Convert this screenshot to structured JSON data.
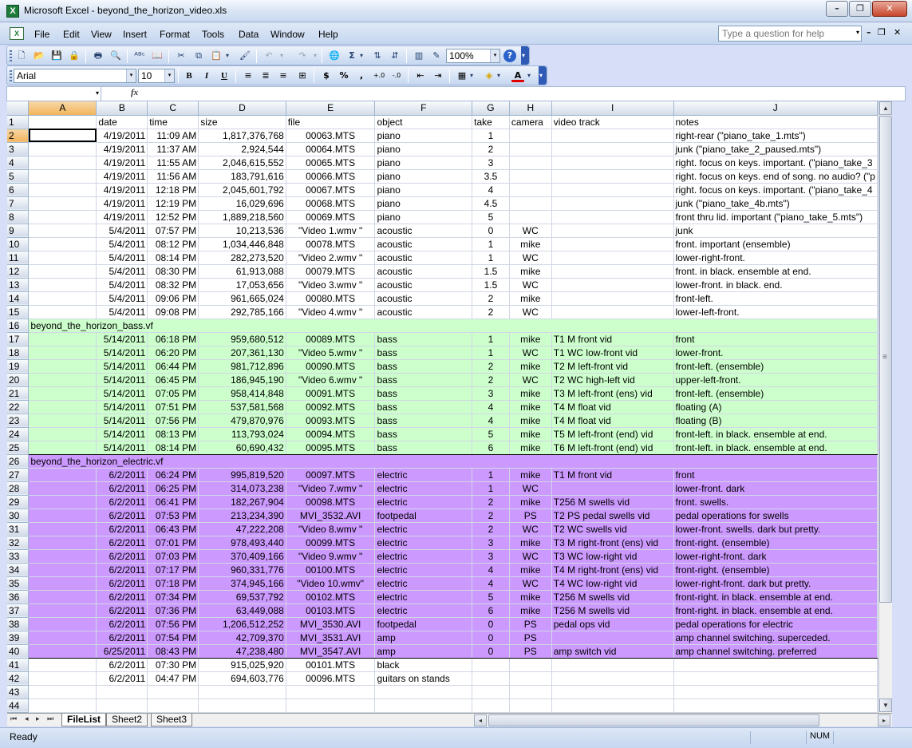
{
  "window": {
    "title": "Microsoft Excel - beyond_the_horizon_video.xls",
    "icon": "excel-icon",
    "app_icon_letter": "X",
    "doc_icon_letter": "X"
  },
  "menu": [
    "File",
    "Edit",
    "View",
    "Insert",
    "Format",
    "Tools",
    "Data",
    "Window",
    "Help"
  ],
  "help_placeholder": "Type a question for help",
  "toolbar": {
    "zoom": "100%",
    "font": "Arial",
    "font_size": "10"
  },
  "formula_bar": {
    "name_box": "",
    "fx": "fx",
    "formula": ""
  },
  "columns": [
    "A",
    "B",
    "C",
    "D",
    "E",
    "F",
    "G",
    "H",
    "I",
    "J"
  ],
  "rows": [
    {
      "n": "1",
      "A": "",
      "B": "date",
      "C": "time",
      "D": "size",
      "E": "file",
      "F": "object",
      "G": "take",
      "H": "camera",
      "I": "video track",
      "J": "notes",
      "hdr": true
    },
    {
      "n": "2",
      "A": "",
      "B": "4/19/2011",
      "C": "11:09 AM",
      "D": "1,817,376,768",
      "E": "00063.MTS",
      "F": "piano",
      "G": "1",
      "H": "",
      "I": "",
      "J": "right-rear (\"piano_take_1.mts\")"
    },
    {
      "n": "3",
      "A": "",
      "B": "4/19/2011",
      "C": "11:37 AM",
      "D": "2,924,544",
      "E": "00064.MTS",
      "F": "piano",
      "G": "2",
      "H": "",
      "I": "",
      "J": "junk (\"piano_take_2_paused.mts\")"
    },
    {
      "n": "4",
      "A": "",
      "B": "4/19/2011",
      "C": "11:55 AM",
      "D": "2,046,615,552",
      "E": "00065.MTS",
      "F": "piano",
      "G": "3",
      "H": "",
      "I": "",
      "J": "right. focus on keys. important. (\"piano_take_3"
    },
    {
      "n": "5",
      "A": "",
      "B": "4/19/2011",
      "C": "11:56 AM",
      "D": "183,791,616",
      "E": "00066.MTS",
      "F": "piano",
      "G": "3.5",
      "H": "",
      "I": "",
      "J": "right. focus on keys. end of song. no audio? (\"p"
    },
    {
      "n": "6",
      "A": "",
      "B": "4/19/2011",
      "C": "12:18 PM",
      "D": "2,045,601,792",
      "E": "00067.MTS",
      "F": "piano",
      "G": "4",
      "H": "",
      "I": "",
      "J": "right. focus on keys. important. (\"piano_take_4"
    },
    {
      "n": "7",
      "A": "",
      "B": "4/19/2011",
      "C": "12:19 PM",
      "D": "16,029,696",
      "E": "00068.MTS",
      "F": "piano",
      "G": "4.5",
      "H": "",
      "I": "",
      "J": "junk (\"piano_take_4b.mts\")"
    },
    {
      "n": "8",
      "A": "",
      "B": "4/19/2011",
      "C": "12:52 PM",
      "D": "1,889,218,560",
      "E": "00069.MTS",
      "F": "piano",
      "G": "5",
      "H": "",
      "I": "",
      "J": "front thru lid. important (\"piano_take_5.mts\")"
    },
    {
      "n": "9",
      "A": "",
      "B": "5/4/2011",
      "C": "07:57 PM",
      "D": "10,213,536",
      "E": "\"Video 1.wmv \"",
      "F": "acoustic",
      "G": "0",
      "H": "WC",
      "I": "",
      "J": "junk"
    },
    {
      "n": "10",
      "A": "",
      "B": "5/4/2011",
      "C": "08:12 PM",
      "D": "1,034,446,848",
      "E": "00078.MTS",
      "F": "acoustic",
      "G": "1",
      "H": "mike",
      "I": "",
      "J": "front. important (ensemble)"
    },
    {
      "n": "11",
      "A": "",
      "B": "5/4/2011",
      "C": "08:14 PM",
      "D": "282,273,520",
      "E": "\"Video 2.wmv \"",
      "F": "acoustic",
      "G": "1",
      "H": "WC",
      "I": "",
      "J": "lower-right-front."
    },
    {
      "n": "12",
      "A": "",
      "B": "5/4/2011",
      "C": "08:30 PM",
      "D": "61,913,088",
      "E": "00079.MTS",
      "F": "acoustic",
      "G": "1.5",
      "H": "mike",
      "I": "",
      "J": "front. in black. ensemble at end."
    },
    {
      "n": "13",
      "A": "",
      "B": "5/4/2011",
      "C": "08:32 PM",
      "D": "17,053,656",
      "E": "\"Video 3.wmv \"",
      "F": "acoustic",
      "G": "1.5",
      "H": "WC",
      "I": "",
      "J": "lower-front. in black. end."
    },
    {
      "n": "14",
      "A": "",
      "B": "5/4/2011",
      "C": "09:06 PM",
      "D": "961,665,024",
      "E": "00080.MTS",
      "F": "acoustic",
      "G": "2",
      "H": "mike",
      "I": "",
      "J": "front-left."
    },
    {
      "n": "15",
      "A": "",
      "B": "5/4/2011",
      "C": "09:08 PM",
      "D": "292,785,166",
      "E": "\"Video 4.wmv \"",
      "F": "acoustic",
      "G": "2",
      "H": "WC",
      "I": "",
      "J": "lower-left-front."
    },
    {
      "n": "16",
      "A": "beyond_the_horizon_bass.vf",
      "group": "green",
      "section": true
    },
    {
      "n": "17",
      "A": "",
      "B": "5/14/2011",
      "C": "06:18 PM",
      "D": "959,680,512",
      "E": "00089.MTS",
      "F": "bass",
      "G": "1",
      "H": "mike",
      "I": "T1 M front vid",
      "J": "front",
      "group": "green"
    },
    {
      "n": "18",
      "A": "",
      "B": "5/14/2011",
      "C": "06:20 PM",
      "D": "207,361,130",
      "E": "\"Video 5.wmv \"",
      "F": "bass",
      "G": "1",
      "H": "WC",
      "I": "T1 WC low-front vid",
      "J": "lower-front.",
      "group": "green"
    },
    {
      "n": "19",
      "A": "",
      "B": "5/14/2011",
      "C": "06:44 PM",
      "D": "981,712,896",
      "E": "00090.MTS",
      "F": "bass",
      "G": "2",
      "H": "mike",
      "I": "T2 M left-front vid",
      "J": "front-left. (ensemble)",
      "group": "green"
    },
    {
      "n": "20",
      "A": "",
      "B": "5/14/2011",
      "C": "06:45 PM",
      "D": "186,945,190",
      "E": "\"Video 6.wmv \"",
      "F": "bass",
      "G": "2",
      "H": "WC",
      "I": "T2 WC high-left vid",
      "J": "upper-left-front.",
      "group": "green"
    },
    {
      "n": "21",
      "A": "",
      "B": "5/14/2011",
      "C": "07:05 PM",
      "D": "958,414,848",
      "E": "00091.MTS",
      "F": "bass",
      "G": "3",
      "H": "mike",
      "I": "T3 M left-front (ens) vid",
      "J": "front-left. (ensemble)",
      "group": "green"
    },
    {
      "n": "22",
      "A": "",
      "B": "5/14/2011",
      "C": "07:51 PM",
      "D": "537,581,568",
      "E": "00092.MTS",
      "F": "bass",
      "G": "4",
      "H": "mike",
      "I": "T4 M float vid",
      "J": "floating (A)",
      "group": "green"
    },
    {
      "n": "23",
      "A": "",
      "B": "5/14/2011",
      "C": "07:56 PM",
      "D": "479,870,976",
      "E": "00093.MTS",
      "F": "bass",
      "G": "4",
      "H": "mike",
      "I": "T4 M float vid",
      "J": "floating (B)",
      "group": "green"
    },
    {
      "n": "24",
      "A": "",
      "B": "5/14/2011",
      "C": "08:13 PM",
      "D": "113,793,024",
      "E": "00094.MTS",
      "F": "bass",
      "G": "5",
      "H": "mike",
      "I": "T5 M left-front (end) vid",
      "J": "front-left. in black. ensemble at end.",
      "group": "green"
    },
    {
      "n": "25",
      "A": "",
      "B": "5/14/2011",
      "C": "08:14 PM",
      "D": "60,690,432",
      "E": "00095.MTS",
      "F": "bass",
      "G": "6",
      "H": "mike",
      "I": "T6 M left-front (end) vid",
      "J": "front-left. in black. ensemble at end.",
      "group": "green"
    },
    {
      "n": "26",
      "A": "beyond_the_horizon_electric.vf",
      "group": "purple",
      "section": true
    },
    {
      "n": "27",
      "A": "",
      "B": "6/2/2011",
      "C": "06:24 PM",
      "D": "995,819,520",
      "E": "00097.MTS",
      "F": "electric",
      "G": "1",
      "H": "mike",
      "I": "T1 M front vid",
      "J": "front",
      "group": "purple"
    },
    {
      "n": "28",
      "A": "",
      "B": "6/2/2011",
      "C": "06:25 PM",
      "D": "314,073,238",
      "E": "\"Video 7.wmv \"",
      "F": "electric",
      "G": "1",
      "H": "WC",
      "I": "",
      "J": "lower-front. dark",
      "group": "purple"
    },
    {
      "n": "29",
      "A": "",
      "B": "6/2/2011",
      "C": "06:41 PM",
      "D": "182,267,904",
      "E": "00098.MTS",
      "F": "electric",
      "G": "2",
      "H": "mike",
      "I": "T256 M swells vid",
      "J": "front. swells.",
      "group": "purple"
    },
    {
      "n": "30",
      "A": "",
      "B": "6/2/2011",
      "C": "07:53 PM",
      "D": "213,234,390",
      "E": "MVI_3532.AVI",
      "F": "footpedal",
      "G": "2",
      "H": "PS",
      "I": "T2 PS pedal swells vid",
      "J": "pedal operations for swells",
      "group": "purple"
    },
    {
      "n": "31",
      "A": "",
      "B": "6/2/2011",
      "C": "06:43 PM",
      "D": "47,222,208",
      "E": "\"Video 8.wmv \"",
      "F": "electric",
      "G": "2",
      "H": "WC",
      "I": "T2 WC swells vid",
      "J": "lower-front. swells. dark but pretty.",
      "group": "purple"
    },
    {
      "n": "32",
      "A": "",
      "B": "6/2/2011",
      "C": "07:01 PM",
      "D": "978,493,440",
      "E": "00099.MTS",
      "F": "electric",
      "G": "3",
      "H": "mike",
      "I": "T3 M right-front (ens) vid",
      "J": "front-right. (ensemble)",
      "group": "purple"
    },
    {
      "n": "33",
      "A": "",
      "B": "6/2/2011",
      "C": "07:03 PM",
      "D": "370,409,166",
      "E": "\"Video 9.wmv \"",
      "F": "electric",
      "G": "3",
      "H": "WC",
      "I": "T3 WC low-right vid",
      "J": "lower-right-front. dark",
      "group": "purple"
    },
    {
      "n": "34",
      "A": "",
      "B": "6/2/2011",
      "C": "07:17 PM",
      "D": "960,331,776",
      "E": "00100.MTS",
      "F": "electric",
      "G": "4",
      "H": "mike",
      "I": "T4 M right-front (ens) vid",
      "J": "front-right. (ensemble)",
      "group": "purple"
    },
    {
      "n": "35",
      "A": "",
      "B": "6/2/2011",
      "C": "07:18 PM",
      "D": "374,945,166",
      "E": "\"Video 10.wmv\"",
      "F": "electric",
      "G": "4",
      "H": "WC",
      "I": "T4 WC low-right vid",
      "J": "lower-right-front. dark but pretty.",
      "group": "purple"
    },
    {
      "n": "36",
      "A": "",
      "B": "6/2/2011",
      "C": "07:34 PM",
      "D": "69,537,792",
      "E": "00102.MTS",
      "F": "electric",
      "G": "5",
      "H": "mike",
      "I": "T256 M swells vid",
      "J": "front-right. in black. ensemble at end.",
      "group": "purple"
    },
    {
      "n": "37",
      "A": "",
      "B": "6/2/2011",
      "C": "07:36 PM",
      "D": "63,449,088",
      "E": "00103.MTS",
      "F": "electric",
      "G": "6",
      "H": "mike",
      "I": "T256 M swells vid",
      "J": "front-right. in black. ensemble at end.",
      "group": "purple"
    },
    {
      "n": "38",
      "A": "",
      "B": "6/2/2011",
      "C": "07:56 PM",
      "D": "1,206,512,252",
      "E": "MVI_3530.AVI",
      "F": "footpedal",
      "G": "0",
      "H": "PS",
      "I": "pedal ops vid",
      "J": "pedal operations for electric",
      "group": "purple"
    },
    {
      "n": "39",
      "A": "",
      "B": "6/2/2011",
      "C": "07:54 PM",
      "D": "42,709,370",
      "E": "MVI_3531.AVI",
      "F": "amp",
      "G": "0",
      "H": "PS",
      "I": "",
      "J": "amp channel switching. superceded.",
      "group": "purple"
    },
    {
      "n": "40",
      "A": "",
      "B": "6/25/2011",
      "C": "08:43 PM",
      "D": "47,238,480",
      "E": "MVI_3547.AVI",
      "F": "amp",
      "G": "0",
      "H": "PS",
      "I": "amp switch vid",
      "J": "amp channel switching. preferred",
      "group": "purple"
    },
    {
      "n": "41",
      "A": "",
      "B": "6/2/2011",
      "C": "07:30 PM",
      "D": "915,025,920",
      "E": "00101.MTS",
      "F": "black",
      "G": "",
      "H": "",
      "I": "",
      "J": ""
    },
    {
      "n": "42",
      "A": "",
      "B": "6/2/2011",
      "C": "04:47 PM",
      "D": "694,603,776",
      "E": "00096.MTS",
      "F": "guitars on stands",
      "G": "",
      "H": "",
      "I": "",
      "J": ""
    },
    {
      "n": "43"
    },
    {
      "n": "44"
    }
  ],
  "sheet_tabs": [
    "FileList",
    "Sheet2",
    "Sheet3"
  ],
  "active_sheet": "FileList",
  "status": {
    "text": "Ready",
    "num": "NUM"
  },
  "colors": {
    "green_group": "#ccffcc",
    "purple_group": "#cc99ff",
    "selected_header": "#f1b45c"
  },
  "toolbar_glyphs": {
    "new": "🗋",
    "open": "📂",
    "save": "💾",
    "permission": "🔒",
    "print": "🖶",
    "preview": "🔍",
    "spelling": "ᴬᴮᶜ",
    "research": "📖",
    "cut": "✂",
    "copy": "⧉",
    "paste": "📋",
    "format_painter": "🖌",
    "undo": "↶",
    "redo": "↷",
    "hyperlink": "🌐",
    "autosum": "Σ",
    "sort_asc": "⇅",
    "sort_desc": "⇵",
    "chart": "▥",
    "drawing": "✎",
    "help": "?",
    "bold": "B",
    "italic": "I",
    "underline": "U",
    "align_left": "≡",
    "center": "≣",
    "align_right": "≡",
    "merge": "⊞",
    "currency": "$",
    "percent": "%",
    "comma": ",",
    "inc_decimal": "+.0",
    "dec_decimal": "-.0",
    "dec_indent": "⇤",
    "inc_indent": "⇥",
    "borders": "▦",
    "fill": "◈",
    "font_color": "A",
    "dropdown": "▾",
    "more": "▾",
    "first_sheet": "⏮",
    "prev_sheet": "◂",
    "next_sheet": "▸",
    "last_sheet": "⏭",
    "scroll_up": "▲",
    "scroll_down": "▼",
    "scroll_left": "◂",
    "scroll_right": "▸",
    "grip": "⦙",
    "minimize": "–",
    "restore": "❐",
    "close": "✕",
    "doc_minimize": "–",
    "doc_restore": "❐",
    "doc_close": "✕"
  }
}
